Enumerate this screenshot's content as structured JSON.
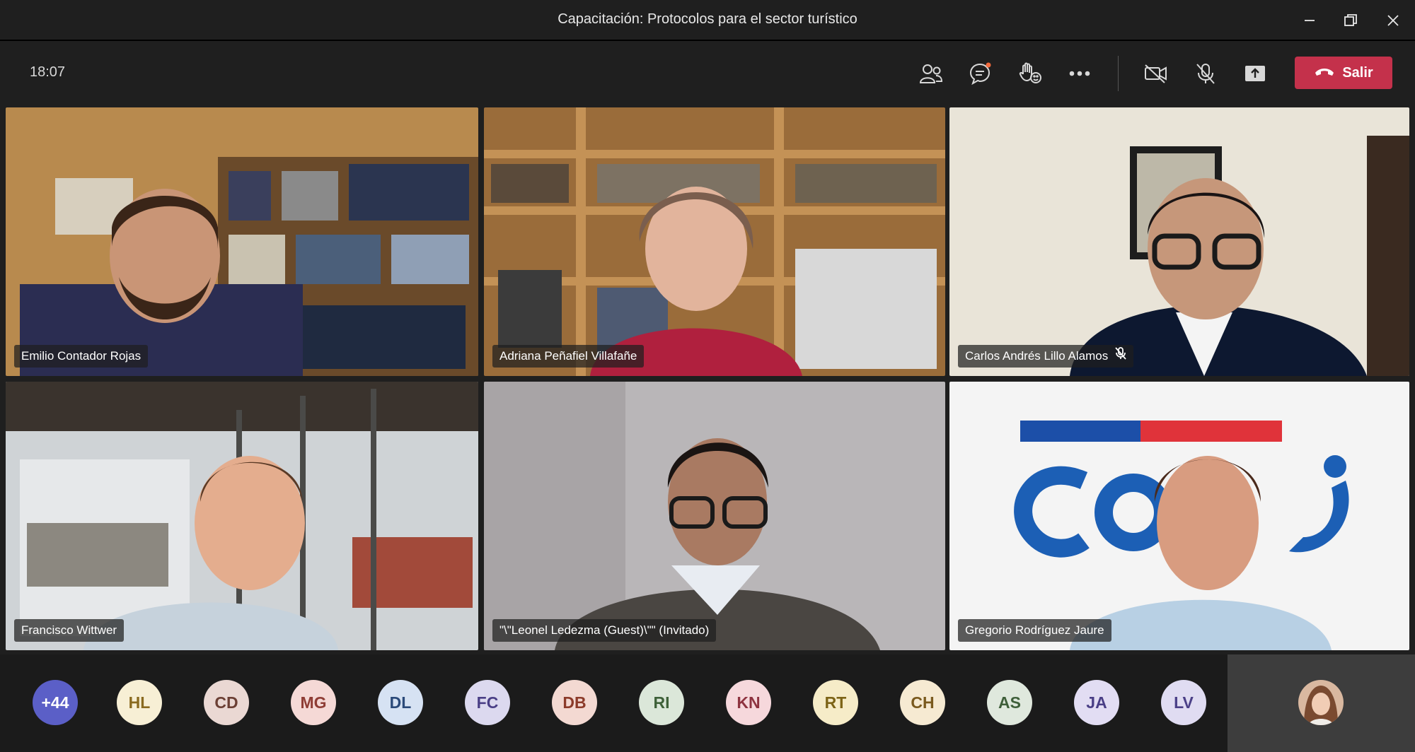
{
  "window": {
    "title": "Capacitación: Protocolos para el sector turístico",
    "minimize_icon": "minimize-icon",
    "restore_icon": "restore-icon",
    "close_icon": "close-icon"
  },
  "toolbar": {
    "time": "18:07",
    "leave_label": "Salir",
    "leave_color": "#c4314b",
    "icons": [
      "participants-icon",
      "chat-icon",
      "reactions-icon",
      "more-icon",
      "camera-off-icon",
      "mic-off-icon",
      "share-screen-icon",
      "phone-hangup-icon"
    ]
  },
  "participants": [
    {
      "name": "Emilio Contador Rojas",
      "muted": false
    },
    {
      "name": "Adriana Peñafiel Villafañe",
      "muted": false
    },
    {
      "name": "Carlos Andrés Lillo Alamos",
      "muted": true
    },
    {
      "name": "Francisco Wittwer",
      "muted": false
    },
    {
      "name": "\"\\\"Leonel Ledezma (Guest)\\\"\" (Invitado)",
      "muted": false
    },
    {
      "name": "Gregorio Rodríguez Jaure",
      "muted": false
    }
  ],
  "strip": {
    "overflow": "+44",
    "overflow_color": "#5b5fc7",
    "avatars": [
      {
        "initials": "HL",
        "bg": "#f7efd5",
        "fg": "#8a6a1f"
      },
      {
        "initials": "CD",
        "bg": "#ead8d3",
        "fg": "#6b3f34"
      },
      {
        "initials": "MG",
        "bg": "#f5d9d6",
        "fg": "#8f3d35"
      },
      {
        "initials": "DL",
        "bg": "#d6e2f3",
        "fg": "#2b4a7a"
      },
      {
        "initials": "FC",
        "bg": "#dcd9ef",
        "fg": "#4a3f86"
      },
      {
        "initials": "DB",
        "bg": "#f3d9d2",
        "fg": "#8c3b2a"
      },
      {
        "initials": "RI",
        "bg": "#dbe7d9",
        "fg": "#3e6139"
      },
      {
        "initials": "KN",
        "bg": "#f6d8dc",
        "fg": "#8e3340"
      },
      {
        "initials": "RT",
        "bg": "#f6ecc8",
        "fg": "#7d6417"
      },
      {
        "initials": "CH",
        "bg": "#f6ead2",
        "fg": "#7a5a1e"
      },
      {
        "initials": "AS",
        "bg": "#dfe8dd",
        "fg": "#3f5f3a"
      },
      {
        "initials": "JA",
        "bg": "#e2ddf3",
        "fg": "#4a3f86"
      },
      {
        "initials": "LV",
        "bg": "#e0dcf2",
        "fg": "#4b4088"
      }
    ]
  }
}
